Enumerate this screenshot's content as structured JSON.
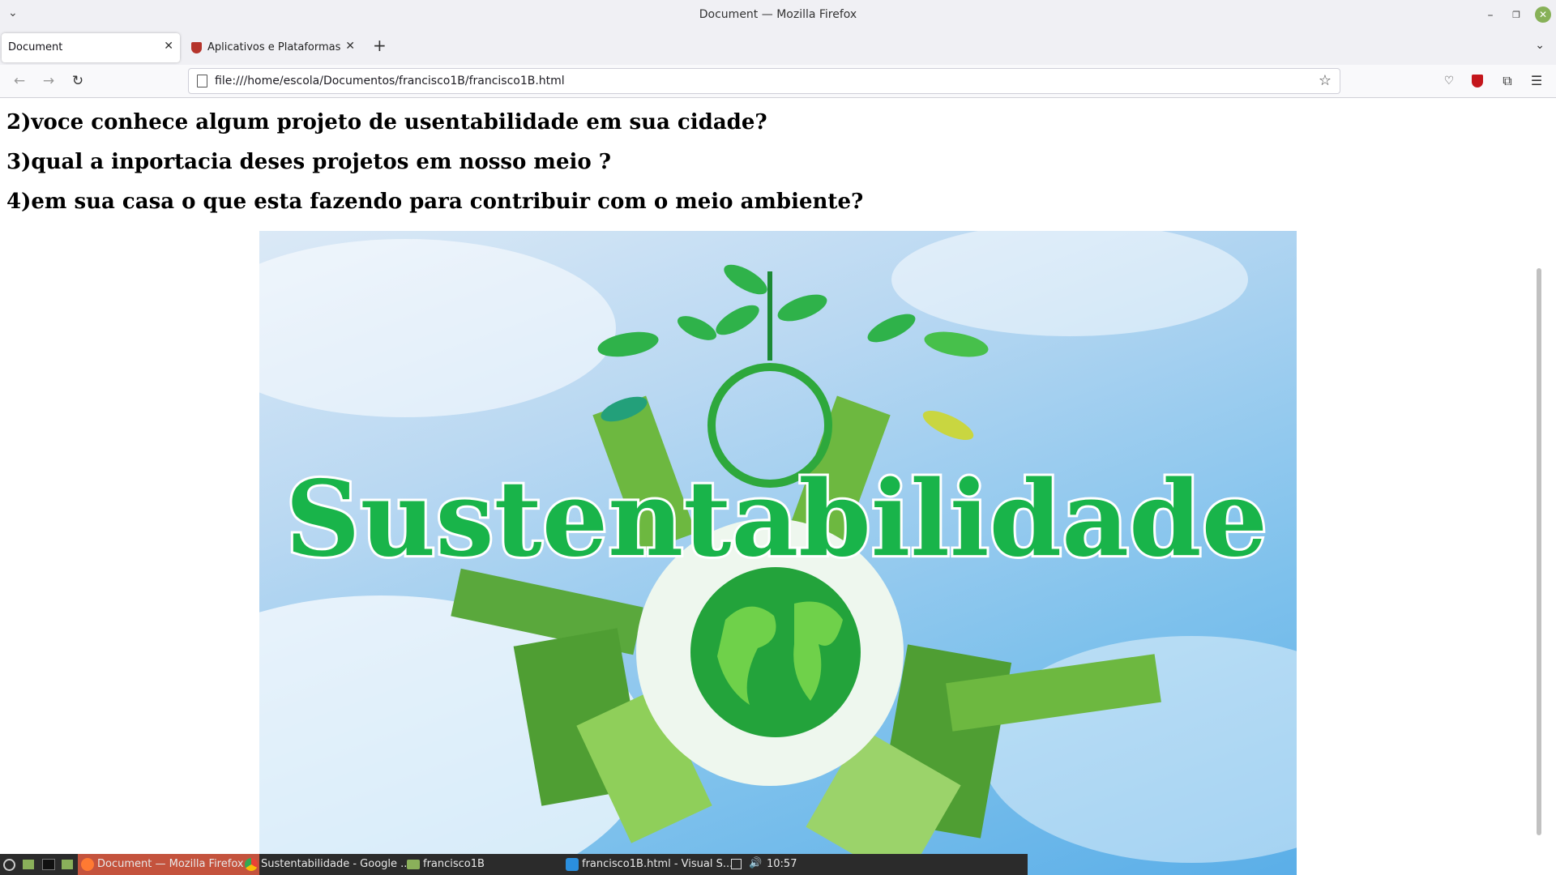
{
  "window": {
    "title": "Document — Mozilla Firefox"
  },
  "tabs": [
    {
      "label": "Document",
      "active": true
    },
    {
      "label": "Aplicativos e Plataformas E",
      "active": false
    }
  ],
  "navbar": {
    "url": "file:///home/escola/Documentos/francisco1B/francisco1B.html"
  },
  "page": {
    "questions": [
      "2)voce conhece algum projeto de usentabilidade em sua cidade?",
      "3)qual a inportacia deses projetos em nosso meio ?",
      "4)em sua casa o que esta fazendo para contribuir com o meio ambiente?"
    ],
    "image_word": "Sustentabilidade"
  },
  "taskbar": {
    "items": [
      {
        "label": "Document — Mozilla Firefox",
        "active": true
      },
      {
        "label": "Sustentabilidade - Google ...",
        "active": false
      },
      {
        "label": "francisco1B",
        "active": false
      },
      {
        "label": "francisco1B.html - Visual S...",
        "active": false
      }
    ],
    "clock": "10:57"
  },
  "colors": {
    "accent_green": "#1aa34a",
    "taskbar_active": "#c4533d"
  }
}
